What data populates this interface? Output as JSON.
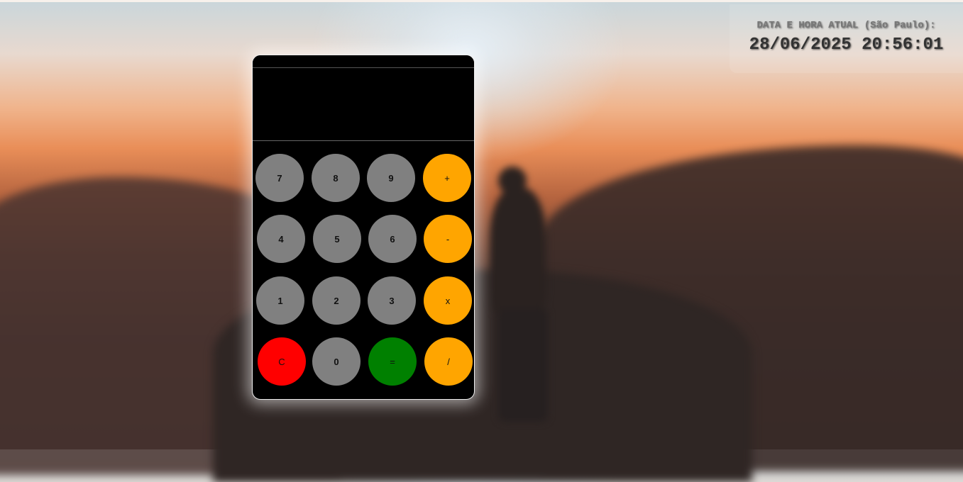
{
  "clock": {
    "label": "DATA E HORA ATUAL (São Paulo):",
    "value": "28/06/2025 20:56:01"
  },
  "calculator": {
    "display": "",
    "keys": {
      "k7": "7",
      "k8": "8",
      "k9": "9",
      "plus": "+",
      "k4": "4",
      "k5": "5",
      "k6": "6",
      "minus": "-",
      "k1": "1",
      "k2": "2",
      "k3": "3",
      "times": "x",
      "clear": "C",
      "k0": "0",
      "equals": "=",
      "divide": "/"
    }
  },
  "colors": {
    "number_key": "#808080",
    "operator_key": "#ffa500",
    "clear_key": "#ff0000",
    "equals_key": "#008000",
    "calculator_body": "#000000"
  }
}
